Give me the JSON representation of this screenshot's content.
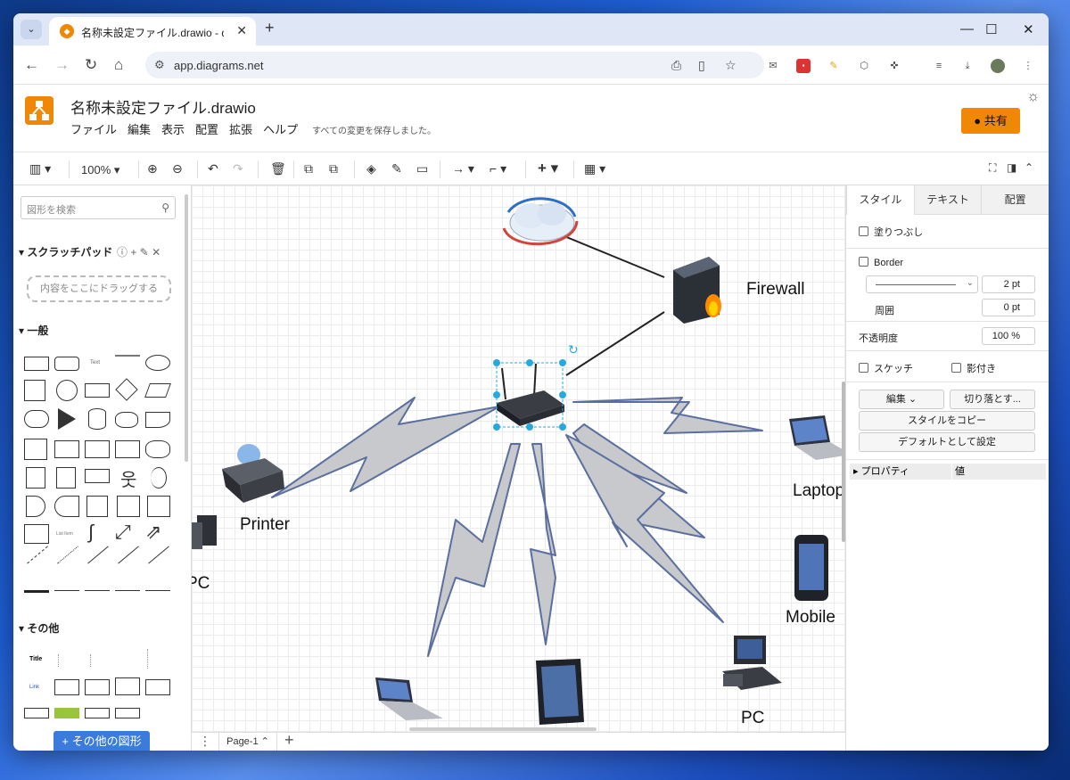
{
  "browser": {
    "tab_title": "名称未設定ファイル.drawio - draw",
    "url": "app.diagrams.net"
  },
  "app": {
    "file_title": "名称未設定ファイル.drawio",
    "menus": [
      "ファイル",
      "編集",
      "表示",
      "配置",
      "拡張",
      "ヘルプ"
    ],
    "save_status": "すべての変更を保存しました。",
    "share_label": "共有"
  },
  "toolbar": {
    "zoom": "100%"
  },
  "sidebar": {
    "search_placeholder": "図形を検索",
    "scratchpad_title": "スクラッチパッド",
    "scratchpad_drop": "内容をここにドラッグする",
    "general_title": "一般",
    "other_title": "その他",
    "more_shapes": "その他の図形"
  },
  "canvas": {
    "labels": {
      "firewall": "Firewall",
      "printer": "Printer",
      "pc_left": "PC",
      "laptop": "Laptop",
      "mobile": "Mobile",
      "pc_bottom": "PC"
    }
  },
  "pages": {
    "current": "Page-1"
  },
  "format_panel": {
    "tabs": [
      "スタイル",
      "テキスト",
      "配置"
    ],
    "fill": "塗りつぶし",
    "border": "Border",
    "border_width": "2 pt",
    "perimeter_label": "周囲",
    "perimeter_value": "0 pt",
    "opacity_label": "不透明度",
    "opacity_value": "100 %",
    "sketch": "スケッチ",
    "shadow": "影付き",
    "edit_select": "編集",
    "crop": "切り落とす...",
    "copy_style": "スタイルをコピー",
    "set_default": "デフォルトとして設定",
    "prop_header": "プロパティ",
    "value_header": "値"
  },
  "colors": {
    "accent": "#f08705",
    "selection": "#29a8e0",
    "bolt_fill": "#c7c9cd",
    "bolt_stroke": "#5b6f9e",
    "button_blue": "#3a7bdc"
  }
}
